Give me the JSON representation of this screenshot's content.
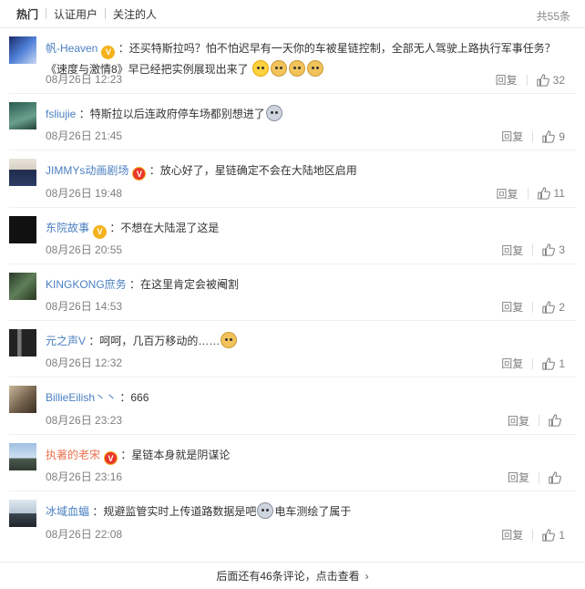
{
  "tabs": [
    {
      "label": "热门"
    },
    {
      "label": "认证用户"
    },
    {
      "label": "关注的人"
    }
  ],
  "total": "共55条",
  "reply_label": "回复",
  "comments": [
    {
      "user": "帆-Heaven",
      "text": "：还买特斯拉吗？怕不怕迟早有一天你的车被星链控制，全部无人驾驶上路执行军事任务？《速度与激情8》早已经把实例展现出来了",
      "time": "08月26日 12:23",
      "likes": "32"
    },
    {
      "user": "fsliujie",
      "text": "：特斯拉以后连政府停车场都别想进了",
      "time": "08月26日 21:45",
      "likes": "9"
    },
    {
      "user": "JIMMYs动画剧场",
      "text": "：放心好了，星链确定不会在大陆地区启用",
      "time": "08月26日 19:48",
      "likes": "11"
    },
    {
      "user": "东院故事",
      "text": "：不想在大陆混了这是",
      "time": "08月26日 20:55",
      "likes": "3"
    },
    {
      "user": "KINGKONG庶务",
      "text": "：在这里肯定会被阉割",
      "time": "08月26日 14:53",
      "likes": "2"
    },
    {
      "user": "元之声V",
      "text": "：呵呵，几百万移动的……",
      "time": "08月26日 12:32",
      "likes": "1"
    },
    {
      "user": "BillieEilish丶丶",
      "text": "：666",
      "time": "08月26日 23:23",
      "likes": ""
    },
    {
      "user": "执著的老宋",
      "text": "：星链本身就是阴谋论",
      "time": "08月26日 23:16",
      "likes": ""
    },
    {
      "user": "冰域血蝠",
      "text": "：规避监管实时上传道路数据是吧",
      "text2": "电车测绘了属于",
      "time": "08月26日 22:08",
      "likes": "1"
    }
  ],
  "more": "后面还有46条评论，点击查看"
}
